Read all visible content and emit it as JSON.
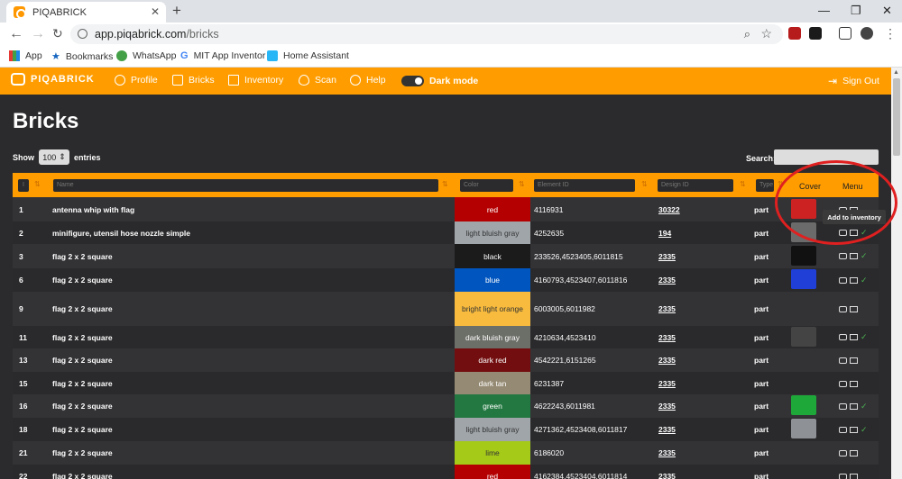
{
  "browser": {
    "tab_title": "PIQABRICK",
    "tab_close": "✕",
    "new_tab": "+",
    "url_host": "app.piqabrick.com",
    "url_path": "/bricks",
    "bookmarks": [
      {
        "label": "App",
        "icon": "apps-grid-icon"
      },
      {
        "label": "Bookmarks",
        "icon": "star-icon"
      },
      {
        "label": "WhatsApp",
        "icon": "whatsapp-icon"
      },
      {
        "label": "MIT App Inventor",
        "icon": "google-icon"
      },
      {
        "label": "Home Assistant",
        "icon": "home-assistant-icon"
      }
    ]
  },
  "app": {
    "logo": "PIQABRICK",
    "nav": [
      {
        "label": "Profile",
        "icon": "user-icon"
      },
      {
        "label": "Bricks",
        "icon": "grid-icon"
      },
      {
        "label": "Inventory",
        "icon": "box-icon"
      },
      {
        "label": "Scan",
        "icon": "eye-icon"
      },
      {
        "label": "Help",
        "icon": "help-icon"
      },
      {
        "label": "Dark mode",
        "icon": "toggle-icon"
      }
    ],
    "sign_out": "Sign Out"
  },
  "page": {
    "title": "Bricks",
    "show_label": "Show",
    "show_value": "100",
    "entries_label": "entries",
    "search_label": "Search:",
    "search_value": ""
  },
  "table": {
    "filters": {
      "id": "I",
      "name": "Name",
      "color": "Color",
      "element": "Element ID",
      "design": "Design ID",
      "type": "Type"
    },
    "headers": {
      "cover": "Cover",
      "menu": "Menu"
    },
    "rows": [
      {
        "id": "1",
        "name": "antenna whip with flag",
        "color": "red",
        "color_hex": "#b40000",
        "color_text": "#ffffff",
        "element": "4116931",
        "design": "30322",
        "type": "part",
        "cover": "#cc2222",
        "ok": false
      },
      {
        "id": "2",
        "name": "minifigure, utensil hose nozzle simple",
        "color": "light bluish gray",
        "color_hex": "#a0a5a9",
        "color_text": "#333333",
        "element": "4252635",
        "design": "194",
        "type": "part",
        "cover": "#6b6b6b",
        "ok": true
      },
      {
        "id": "3",
        "name": "flag 2 x 2 square",
        "color": "black",
        "color_hex": "#1b1b1b",
        "color_text": "#ffffff",
        "element": "233526,4523405,6011815",
        "design": "2335",
        "type": "part",
        "cover": "#111111",
        "ok": true
      },
      {
        "id": "6",
        "name": "flag 2 x 2 square",
        "color": "blue",
        "color_hex": "#0055bf",
        "color_text": "#ffffff",
        "element": "4160793,4523407,6011816",
        "design": "2335",
        "type": "part",
        "cover": "#1f3fd6",
        "ok": true
      },
      {
        "id": "9",
        "name": "flag 2 x 2 square",
        "color": "bright light orange",
        "color_hex": "#f8bb3d",
        "color_text": "#333333",
        "element": "6003005,6011982",
        "design": "2335",
        "type": "part",
        "cover": "",
        "ok": false
      },
      {
        "id": "11",
        "name": "flag 2 x 2 square",
        "color": "dark bluish gray",
        "color_hex": "#6c6e68",
        "color_text": "#ffffff",
        "element": "4210634,4523410",
        "design": "2335",
        "type": "part",
        "cover": "#444444",
        "ok": true
      },
      {
        "id": "13",
        "name": "flag 2 x 2 square",
        "color": "dark red",
        "color_hex": "#720e0f",
        "color_text": "#ffffff",
        "element": "4542221,6151265",
        "design": "2335",
        "type": "part",
        "cover": "",
        "ok": false
      },
      {
        "id": "15",
        "name": "flag 2 x 2 square",
        "color": "dark tan",
        "color_hex": "#958a73",
        "color_text": "#ffffff",
        "element": "6231387",
        "design": "2335",
        "type": "part",
        "cover": "",
        "ok": false
      },
      {
        "id": "16",
        "name": "flag 2 x 2 square",
        "color": "green",
        "color_hex": "#237841",
        "color_text": "#ffffff",
        "element": "4622243,6011981",
        "design": "2335",
        "type": "part",
        "cover": "#1fa83a",
        "ok": true
      },
      {
        "id": "18",
        "name": "flag 2 x 2 square",
        "color": "light bluish gray",
        "color_hex": "#a0a5a9",
        "color_text": "#333333",
        "element": "4271362,4523408,6011817",
        "design": "2335",
        "type": "part",
        "cover": "#8e9296",
        "ok": true
      },
      {
        "id": "21",
        "name": "flag 2 x 2 square",
        "color": "lime",
        "color_hex": "#a5ca18",
        "color_text": "#333333",
        "element": "6186020",
        "design": "2335",
        "type": "part",
        "cover": "",
        "ok": false
      },
      {
        "id": "22",
        "name": "flag 2 x 2 square",
        "color": "red",
        "color_hex": "#b40000",
        "color_text": "#ffffff",
        "element": "4162384,4523404,6011814",
        "design": "2335",
        "type": "part",
        "cover": "",
        "ok": false
      }
    ]
  },
  "tooltip": "Add to inventory"
}
